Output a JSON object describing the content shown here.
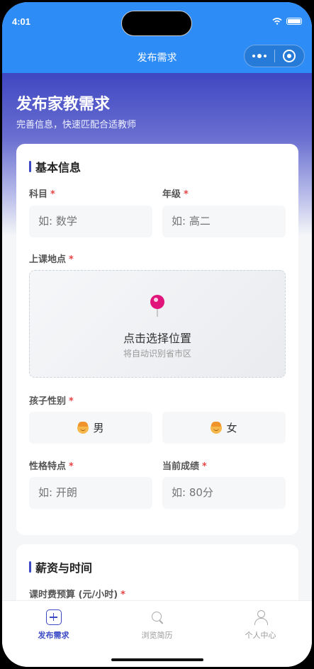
{
  "status": {
    "time": "4:01"
  },
  "nav": {
    "title": "发布需求"
  },
  "hero": {
    "title": "发布家教需求",
    "subtitle": "完善信息，快速匹配合适教师"
  },
  "basic": {
    "title": "基本信息",
    "subject": {
      "label": "科目",
      "required": "*",
      "placeholder": "如: 数学"
    },
    "grade": {
      "label": "年级",
      "required": "*",
      "placeholder": "如: 高二"
    },
    "location": {
      "label": "上课地点",
      "required": "*",
      "main": "点击选择位置",
      "sub": "将自动识别省市区"
    },
    "gender": {
      "label": "孩子性别",
      "required": "*",
      "options": [
        {
          "label": "男"
        },
        {
          "label": "女"
        }
      ]
    },
    "personality": {
      "label": "性格特点",
      "required": "*",
      "placeholder": "如: 开朗"
    },
    "score": {
      "label": "当前成绩",
      "required": "*",
      "placeholder": "如: 80分"
    }
  },
  "salary": {
    "title": "薪资与时间",
    "budget": {
      "label": "课时费预算 (元/小时)",
      "required": "*"
    }
  },
  "tabs": [
    {
      "label": "发布需求",
      "icon": "add-icon",
      "active": true
    },
    {
      "label": "浏览简历",
      "icon": "search-icon",
      "active": false
    },
    {
      "label": "个人中心",
      "icon": "user-icon",
      "active": false
    }
  ],
  "colors": {
    "primary": "#2d8cf6",
    "accent": "#3b49c5",
    "required": "#e64545"
  }
}
